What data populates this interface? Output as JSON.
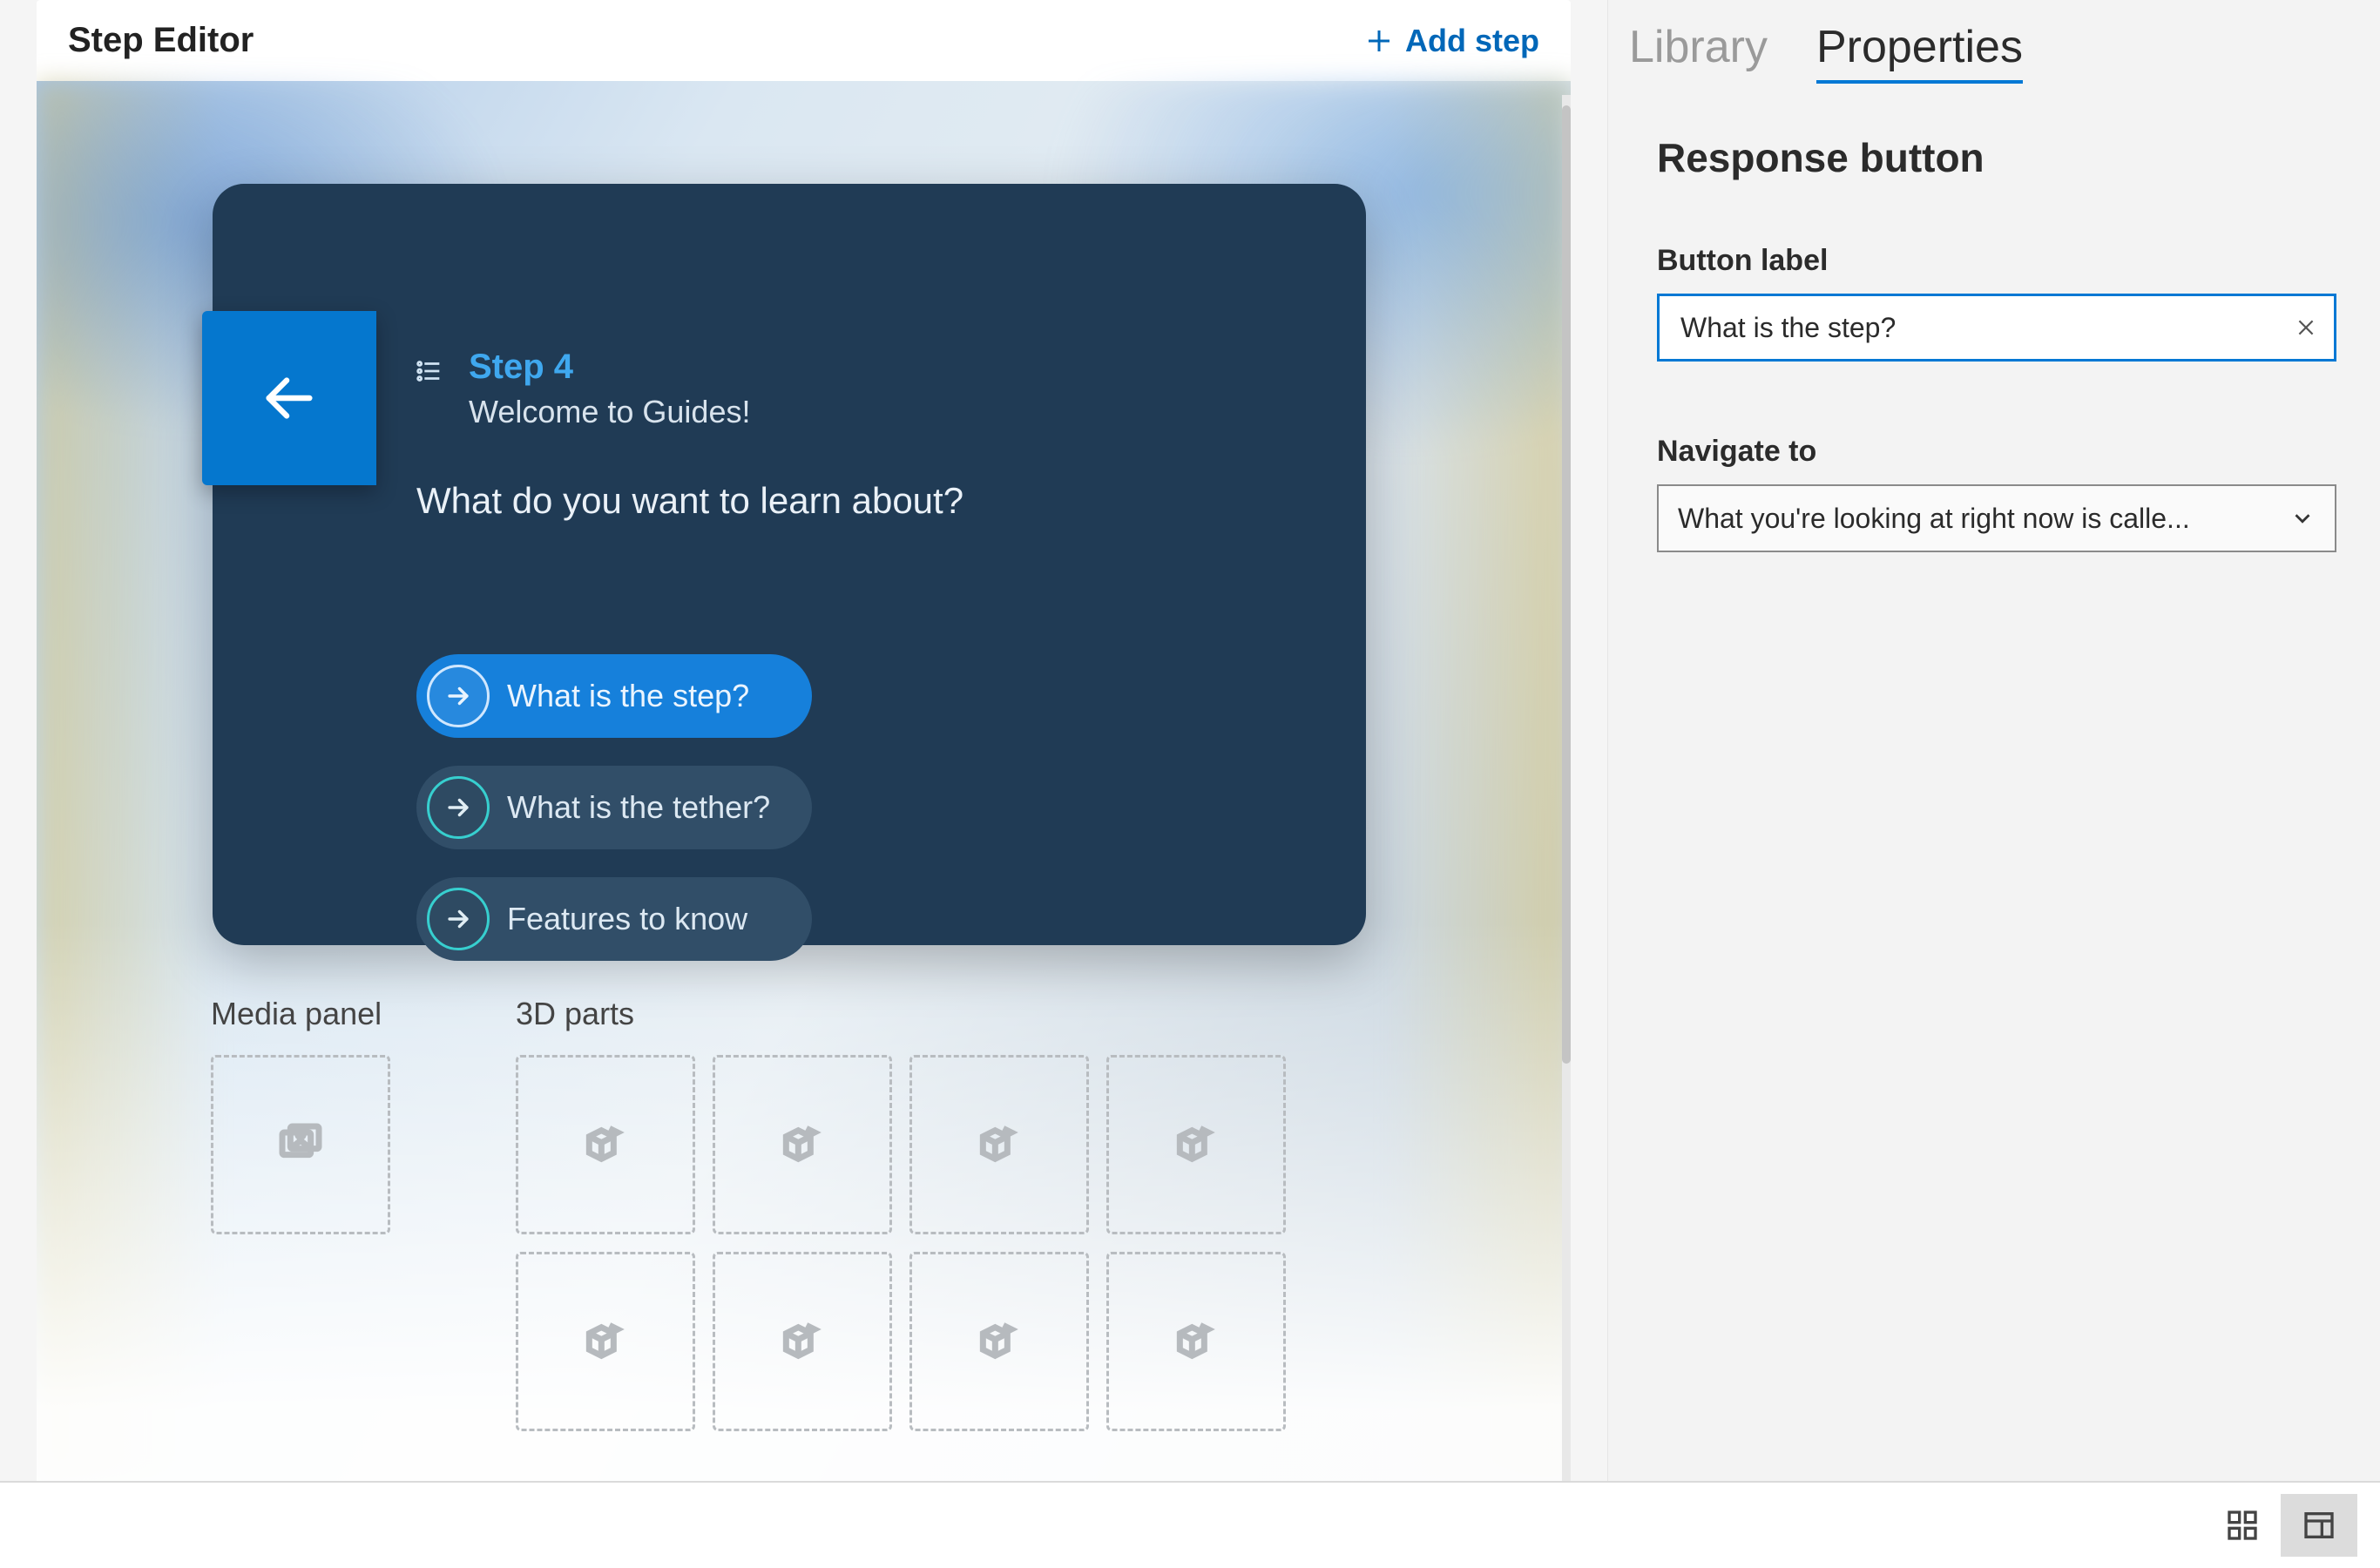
{
  "header": {
    "title": "Step Editor",
    "add_step": "Add step"
  },
  "card": {
    "step_title": "Step 4",
    "subtitle": "Welcome to Guides!",
    "question": "What do you want to learn about?",
    "responses": [
      {
        "label": "What is the step?",
        "active": true
      },
      {
        "label": "What is the tether?",
        "active": false
      },
      {
        "label": "Features to know",
        "active": false
      }
    ]
  },
  "panels": {
    "media_title": "Media panel",
    "parts_title": "3D parts"
  },
  "side": {
    "tabs": {
      "library": "Library",
      "properties": "Properties"
    },
    "heading": "Response button",
    "button_label_field": "Button label",
    "button_label_value": "What is the step?",
    "navigate_label": "Navigate to",
    "navigate_value": "What you're looking at right now is calle..."
  }
}
